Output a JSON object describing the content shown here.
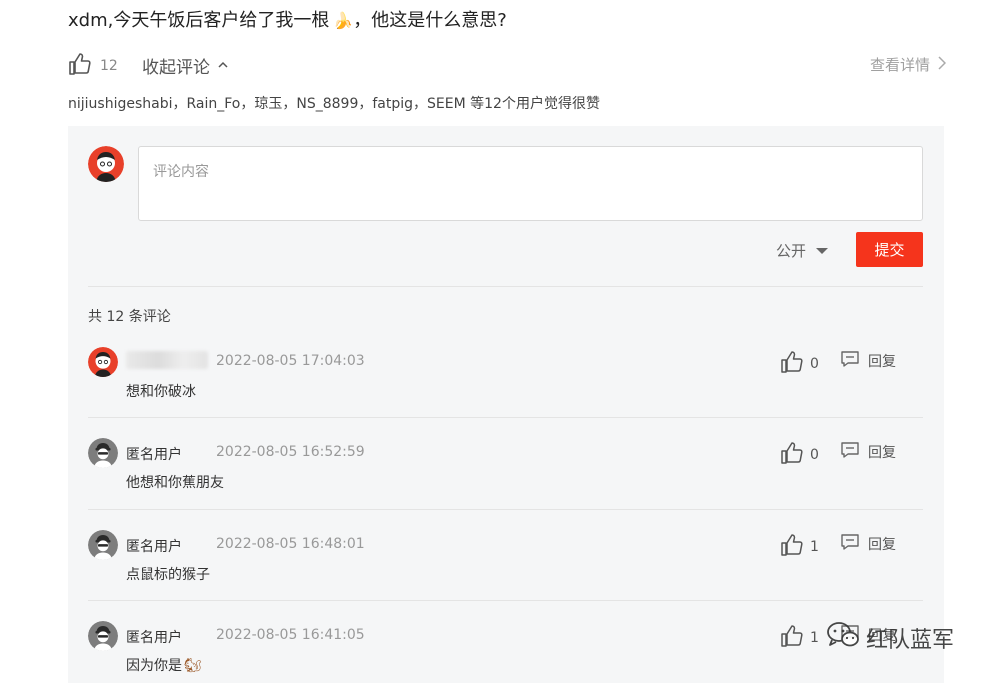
{
  "post": {
    "title": "xdm,今天午饭后客户给了我一根",
    "title_emoji": "🍌",
    "title_suffix": "，他这是什么意思?"
  },
  "actions": {
    "like_count": "12",
    "collapse_label": "收起评论",
    "collapse_icon": "chevron-up",
    "details_label": "查看详情",
    "details_icon": "chevron-right"
  },
  "likers_text": "nijiushigeshabi，Rain_Fo，琼玉，NS_8899，fatpig，SEEM 等12个用户觉得很赞",
  "composer": {
    "placeholder": "评论内容",
    "value": "",
    "visibility": "公开",
    "submit_label": "提交",
    "accent_color": "#f5341c"
  },
  "comment_count_label": "共 12 条评论",
  "comments": [
    {
      "user": "",
      "user_blurred": true,
      "avatar": "cartoon-avatar-red",
      "time": "2022-08-05 17:04:03",
      "text": "想和你破冰",
      "emoji": "",
      "likes": "0",
      "reply_label": "回复"
    },
    {
      "user": "匿名用户",
      "user_blurred": false,
      "avatar": "anonymous-avatar",
      "time": "2022-08-05 16:52:59",
      "text": "他想和你蕉朋友",
      "emoji": "",
      "likes": "0",
      "reply_label": "回复"
    },
    {
      "user": "匿名用户",
      "user_blurred": false,
      "avatar": "anonymous-avatar",
      "time": "2022-08-05 16:48:01",
      "text": "点鼠标的猴子",
      "emoji": "",
      "likes": "1",
      "reply_label": "回复"
    },
    {
      "user": "匿名用户",
      "user_blurred": false,
      "avatar": "anonymous-avatar",
      "time": "2022-08-05 16:41:05",
      "text": "因为你是",
      "emoji": "🐿",
      "likes": "1",
      "reply_label": "回复"
    }
  ],
  "watermark": {
    "text": "红队蓝军",
    "icon": "wechat-icon"
  }
}
